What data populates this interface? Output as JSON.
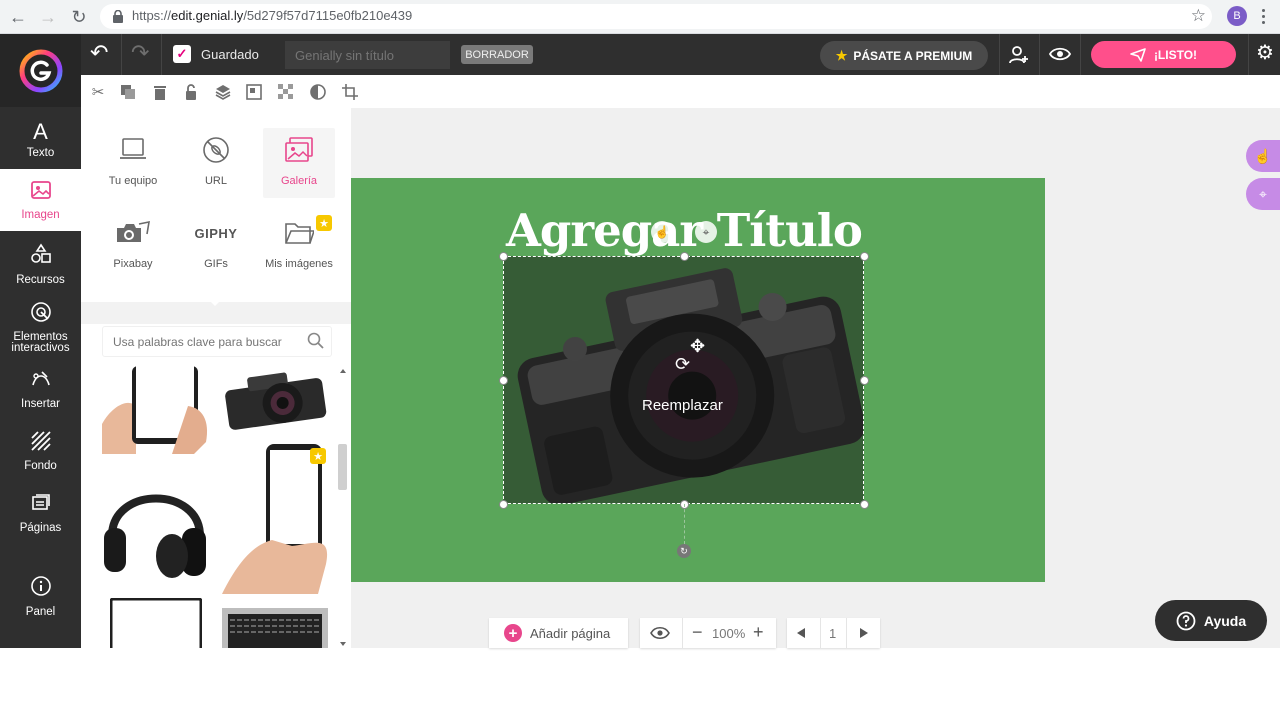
{
  "browser": {
    "url_prefix": "https://",
    "url_domain": "edit.genial.ly",
    "url_path": "/5d279f57d7115e0fb210e439",
    "profile_initial": "B"
  },
  "topbar": {
    "saved_label": "Guardado",
    "title_placeholder": "Genially sin título",
    "draft_badge": "BORRADOR",
    "premium_label": "PÁSATE A PREMIUM",
    "ready_label": "¡LISTO!"
  },
  "sidebar": {
    "items": [
      {
        "label": "Texto",
        "icon": "text-icon"
      },
      {
        "label": "Imagen",
        "icon": "image-icon"
      },
      {
        "label": "Recursos",
        "icon": "resources-icon"
      },
      {
        "label": "Elementos interactivos",
        "icon": "interactive-icon"
      },
      {
        "label": "Insertar",
        "icon": "insert-icon"
      },
      {
        "label": "Fondo",
        "icon": "background-icon"
      },
      {
        "label": "Páginas",
        "icon": "pages-icon"
      },
      {
        "label": "Panel",
        "icon": "info-icon"
      }
    ]
  },
  "panel": {
    "sources": [
      {
        "label": "Tu equipo"
      },
      {
        "label": "URL"
      },
      {
        "label": "Galería"
      },
      {
        "label": "Pixabay"
      },
      {
        "label": "GIFs",
        "logo": "GIPHY"
      },
      {
        "label": "Mis imágenes"
      }
    ],
    "search_placeholder": "Usa palabras clave para buscar"
  },
  "canvas": {
    "slide_title": "Agregar Título",
    "replace_label": "Reemplazar",
    "slide_color": "#5aa65a"
  },
  "bottom": {
    "add_page_label": "Añadir página",
    "zoom_label": "100%",
    "page_number": "1",
    "help_label": "Ayuda"
  },
  "colors": {
    "accent": "#e8468c",
    "ready_button": "#ff4f8b",
    "premium_star": "#f7c800"
  }
}
